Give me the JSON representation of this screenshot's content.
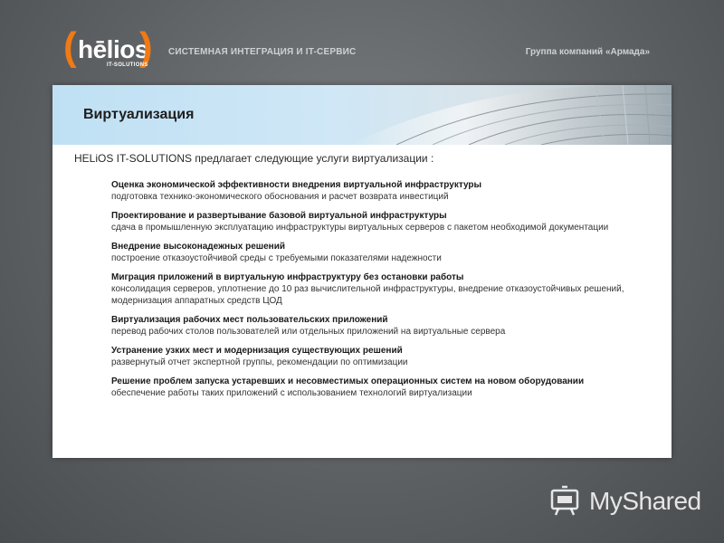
{
  "header": {
    "logo_word": "hēlios",
    "logo_sub": "IT-SOLUTIONS",
    "tagline": "СИСТЕМНАЯ ИНТЕГРАЦИЯ И IT-СЕРВИС",
    "group": "Группа компаний «Армада»"
  },
  "slide": {
    "title": "Виртуализация",
    "intro": "HELiOS IT-SOLUTIONS предлагает следующие услуги виртуализации :",
    "items": [
      {
        "title": "Оценка экономической эффективности внедрения виртуальной инфраструктуры",
        "desc": "подготовка технико-экономического обоснования и расчет возврата инвестиций"
      },
      {
        "title": "Проектирование и развертывание базовой виртуальной инфраструктуры",
        "desc": "сдача в промышленную эксплуатацию инфраструктуры виртуальных серверов с пакетом необходимой документации"
      },
      {
        "title": "Внедрение высоконадежных решений",
        "desc": "построение отказоустойчивой среды с требуемыми показателями надежности"
      },
      {
        "title": "Миграция приложений в виртуальную инфраструктуру без остановки работы",
        "desc": "консолидация серверов, уплотнение до 10 раз вычислительной инфраструктуры, внедрение отказоустойчивых решений, модернизация аппаратных средств ЦОД"
      },
      {
        "title": "Виртуализация рабочих мест пользовательских приложений",
        "desc": "перевод рабочих столов пользователей или отдельных приложений на виртуальные сервера"
      },
      {
        "title": "Устранение узких мест и модернизация существующих решений",
        "desc": "развернутый отчет экспертной группы, рекомендации по оптимизации"
      },
      {
        "title": "Решение проблем запуска устаревших и несовместимых операционных систем на новом оборудовании",
        "desc": "обеспечение работы таких приложений с использованием технологий виртуализации"
      }
    ]
  },
  "watermark": {
    "text": "MyShared",
    "icon": "myshared-icon"
  },
  "colors": {
    "brand_orange": "#f07a14",
    "banner_blue": "#cfe7f6",
    "background": "#5e6164"
  }
}
